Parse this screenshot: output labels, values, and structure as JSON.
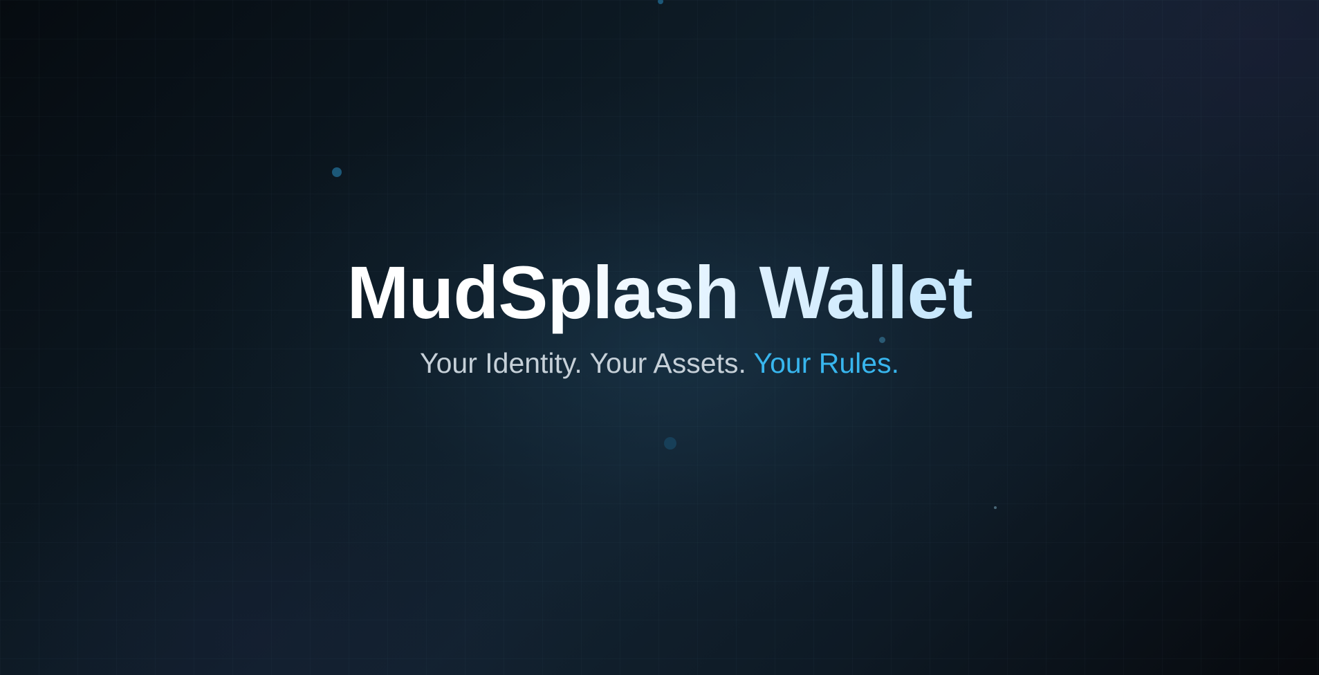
{
  "hero": {
    "title": "MudSplash Wallet",
    "tagline_part1": "Your Identity.",
    "tagline_part2": "Your Assets.",
    "tagline_accent": "Your Rules."
  },
  "colors": {
    "background": "#0c1620",
    "title": "#ffffff",
    "title_gradient_end": "#c4e6fc",
    "tagline": "#c6d0d8",
    "accent": "#38b6ee",
    "particle": "#1c5878"
  }
}
